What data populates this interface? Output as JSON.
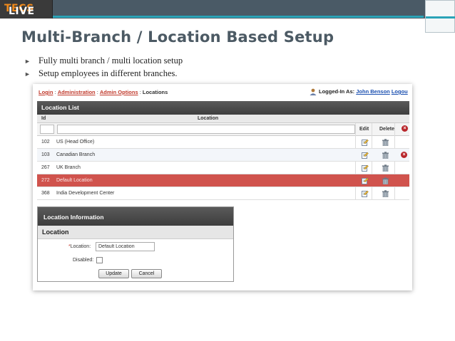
{
  "brand": {
    "prefix": "LIVE",
    "suffix": "TECS"
  },
  "slide": {
    "title": "Multi-Branch / Location Based Setup",
    "bullets": [
      "Fully multi branch / multi location setup",
      "Setup employees in different branches."
    ]
  },
  "app": {
    "breadcrumb": {
      "login": "Login",
      "administration": "Administration",
      "admin_options": "Admin Options",
      "current": "Locations",
      "sep": " : "
    },
    "user": {
      "label": "Logged-In As:",
      "name": "John Benson",
      "logout": "Logou"
    },
    "location_list": {
      "title": "Location List",
      "columns": {
        "id": "Id",
        "location": "Location",
        "edit": "Edit",
        "delete": "Delete"
      },
      "rows": [
        {
          "id": "102",
          "name": "US (Head Office)"
        },
        {
          "id": "103",
          "name": "Canadian Branch"
        },
        {
          "id": "267",
          "name": "UK Branch"
        },
        {
          "id": "272",
          "name": "Default Location"
        },
        {
          "id": "368",
          "name": "India Development Center"
        }
      ],
      "selected_row": "272",
      "colors": {
        "selected": "#d0534d",
        "header": "#4a4a4a",
        "delete_mark": "#b8262b"
      }
    },
    "location_info": {
      "title": "Location Information",
      "subtitle": "Location",
      "required_mark": "*",
      "location_label": "Location:",
      "location_value": "Default Location",
      "disabled_label": "Disabled:",
      "disabled_checked": false,
      "update_label": "Update",
      "cancel_label": "Cancel"
    }
  },
  "colors": {
    "accent": "#2aa3b7",
    "brand_orange": "#f08a1c",
    "title": "#4c5a64"
  },
  "icons": [
    "person-icon",
    "edit-icon",
    "trash-icon",
    "delete-x-icon",
    "bullet-arrow-icon"
  ]
}
